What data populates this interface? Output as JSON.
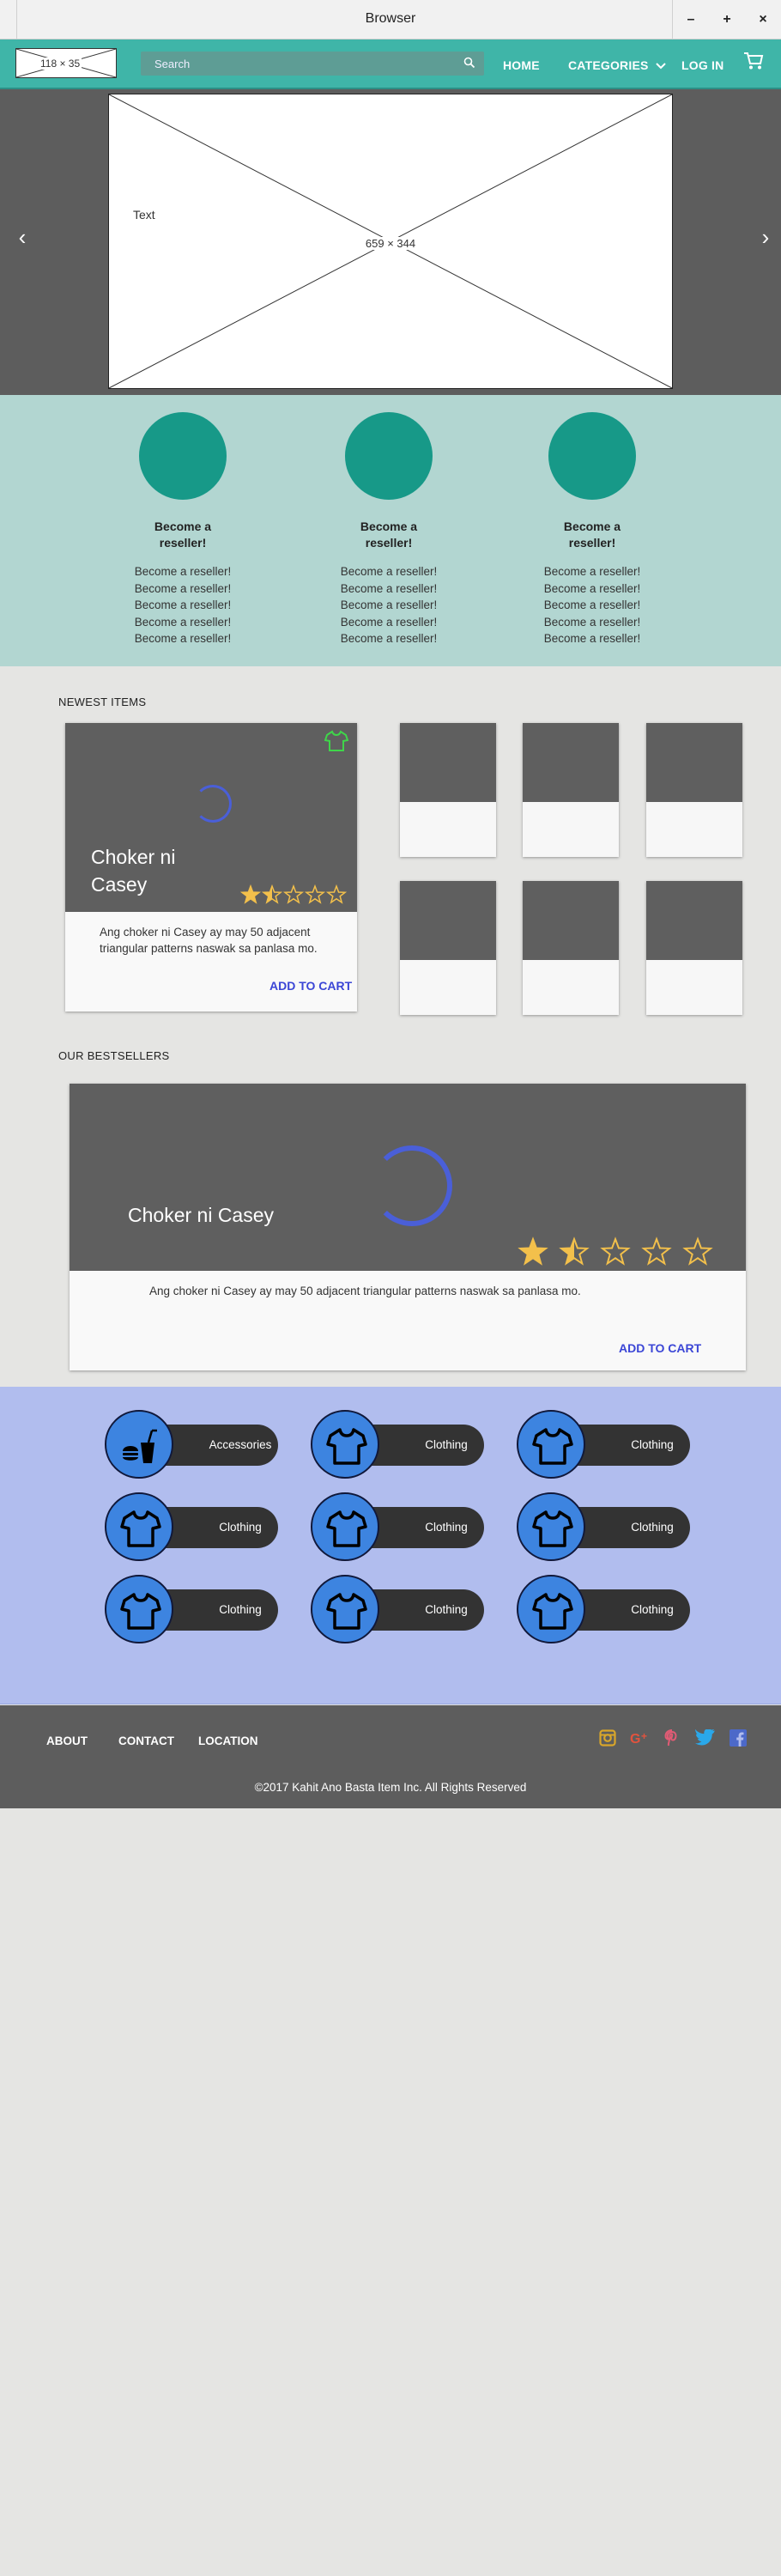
{
  "browser": {
    "title": "Browser",
    "minimize": "–",
    "maximize": "+",
    "close": "×"
  },
  "nav": {
    "logo_text": "118 × 35",
    "search_placeholder": "Search",
    "home": "HOME",
    "categories": "CATEGORIES",
    "login": "LOG IN"
  },
  "hero": {
    "text": "Text",
    "size_label": "659 × 344"
  },
  "resellers": [
    {
      "title_line1": "Become a",
      "title_line2": "reseller!",
      "lines": [
        "Become a reseller!",
        "Become a reseller!",
        "Become a reseller!",
        "Become a reseller!",
        "Become a reseller!"
      ]
    },
    {
      "title_line1": "Become a",
      "title_line2": "reseller!",
      "lines": [
        "Become a reseller!",
        "Become a reseller!",
        "Become a reseller!",
        "Become a reseller!",
        "Become a reseller!"
      ]
    },
    {
      "title_line1": "Become a",
      "title_line2": "reseller!",
      "lines": [
        "Become a reseller!",
        "Become a reseller!",
        "Become a reseller!",
        "Become a reseller!",
        "Become a reseller!"
      ]
    }
  ],
  "newest": {
    "heading": "NEWEST ITEMS",
    "featured": {
      "name_line1": "Choker ni",
      "name_line2": "Casey",
      "description": "Ang choker ni Casey ay may 50 adjacent triangular patterns naswak sa panlasa mo.",
      "cta": "ADD TO CART",
      "rating": 1.5,
      "rating_max": 5
    }
  },
  "bestsellers": {
    "heading": "OUR BESTSELLERS",
    "name": "Choker ni Casey",
    "description": "Ang choker ni Casey ay may 50 adjacent triangular patterns naswak sa panlasa mo.",
    "cta": "ADD TO CART",
    "rating": 1.5,
    "rating_max": 5
  },
  "categories": [
    {
      "label": "Accessories",
      "icon": "food-drink-icon"
    },
    {
      "label": "Clothing",
      "icon": "shirt-icon"
    },
    {
      "label": "Clothing",
      "icon": "shirt-icon"
    },
    {
      "label": "Clothing",
      "icon": "shirt-icon"
    },
    {
      "label": "Clothing",
      "icon": "shirt-icon"
    },
    {
      "label": "Clothing",
      "icon": "shirt-icon"
    },
    {
      "label": "Clothing",
      "icon": "shirt-icon"
    },
    {
      "label": "Clothing",
      "icon": "shirt-icon"
    },
    {
      "label": "Clothing",
      "icon": "shirt-icon"
    }
  ],
  "footer": {
    "about": "ABOUT",
    "contact": "CONTACT",
    "location": "LOCATION",
    "copyright": "©2017 Kahit Ano Basta Item Inc. All Rights Reserved"
  },
  "colors": {
    "nav": "#3fb5a8",
    "reseller_bg": "#b2d6d1",
    "reseller_circle": "#179988",
    "cta": "#3b46d6",
    "categories_bg": "#b1bdee",
    "category_circle": "#3d84e0",
    "footer": "#5d5d5d",
    "star": "#f3c04b"
  }
}
